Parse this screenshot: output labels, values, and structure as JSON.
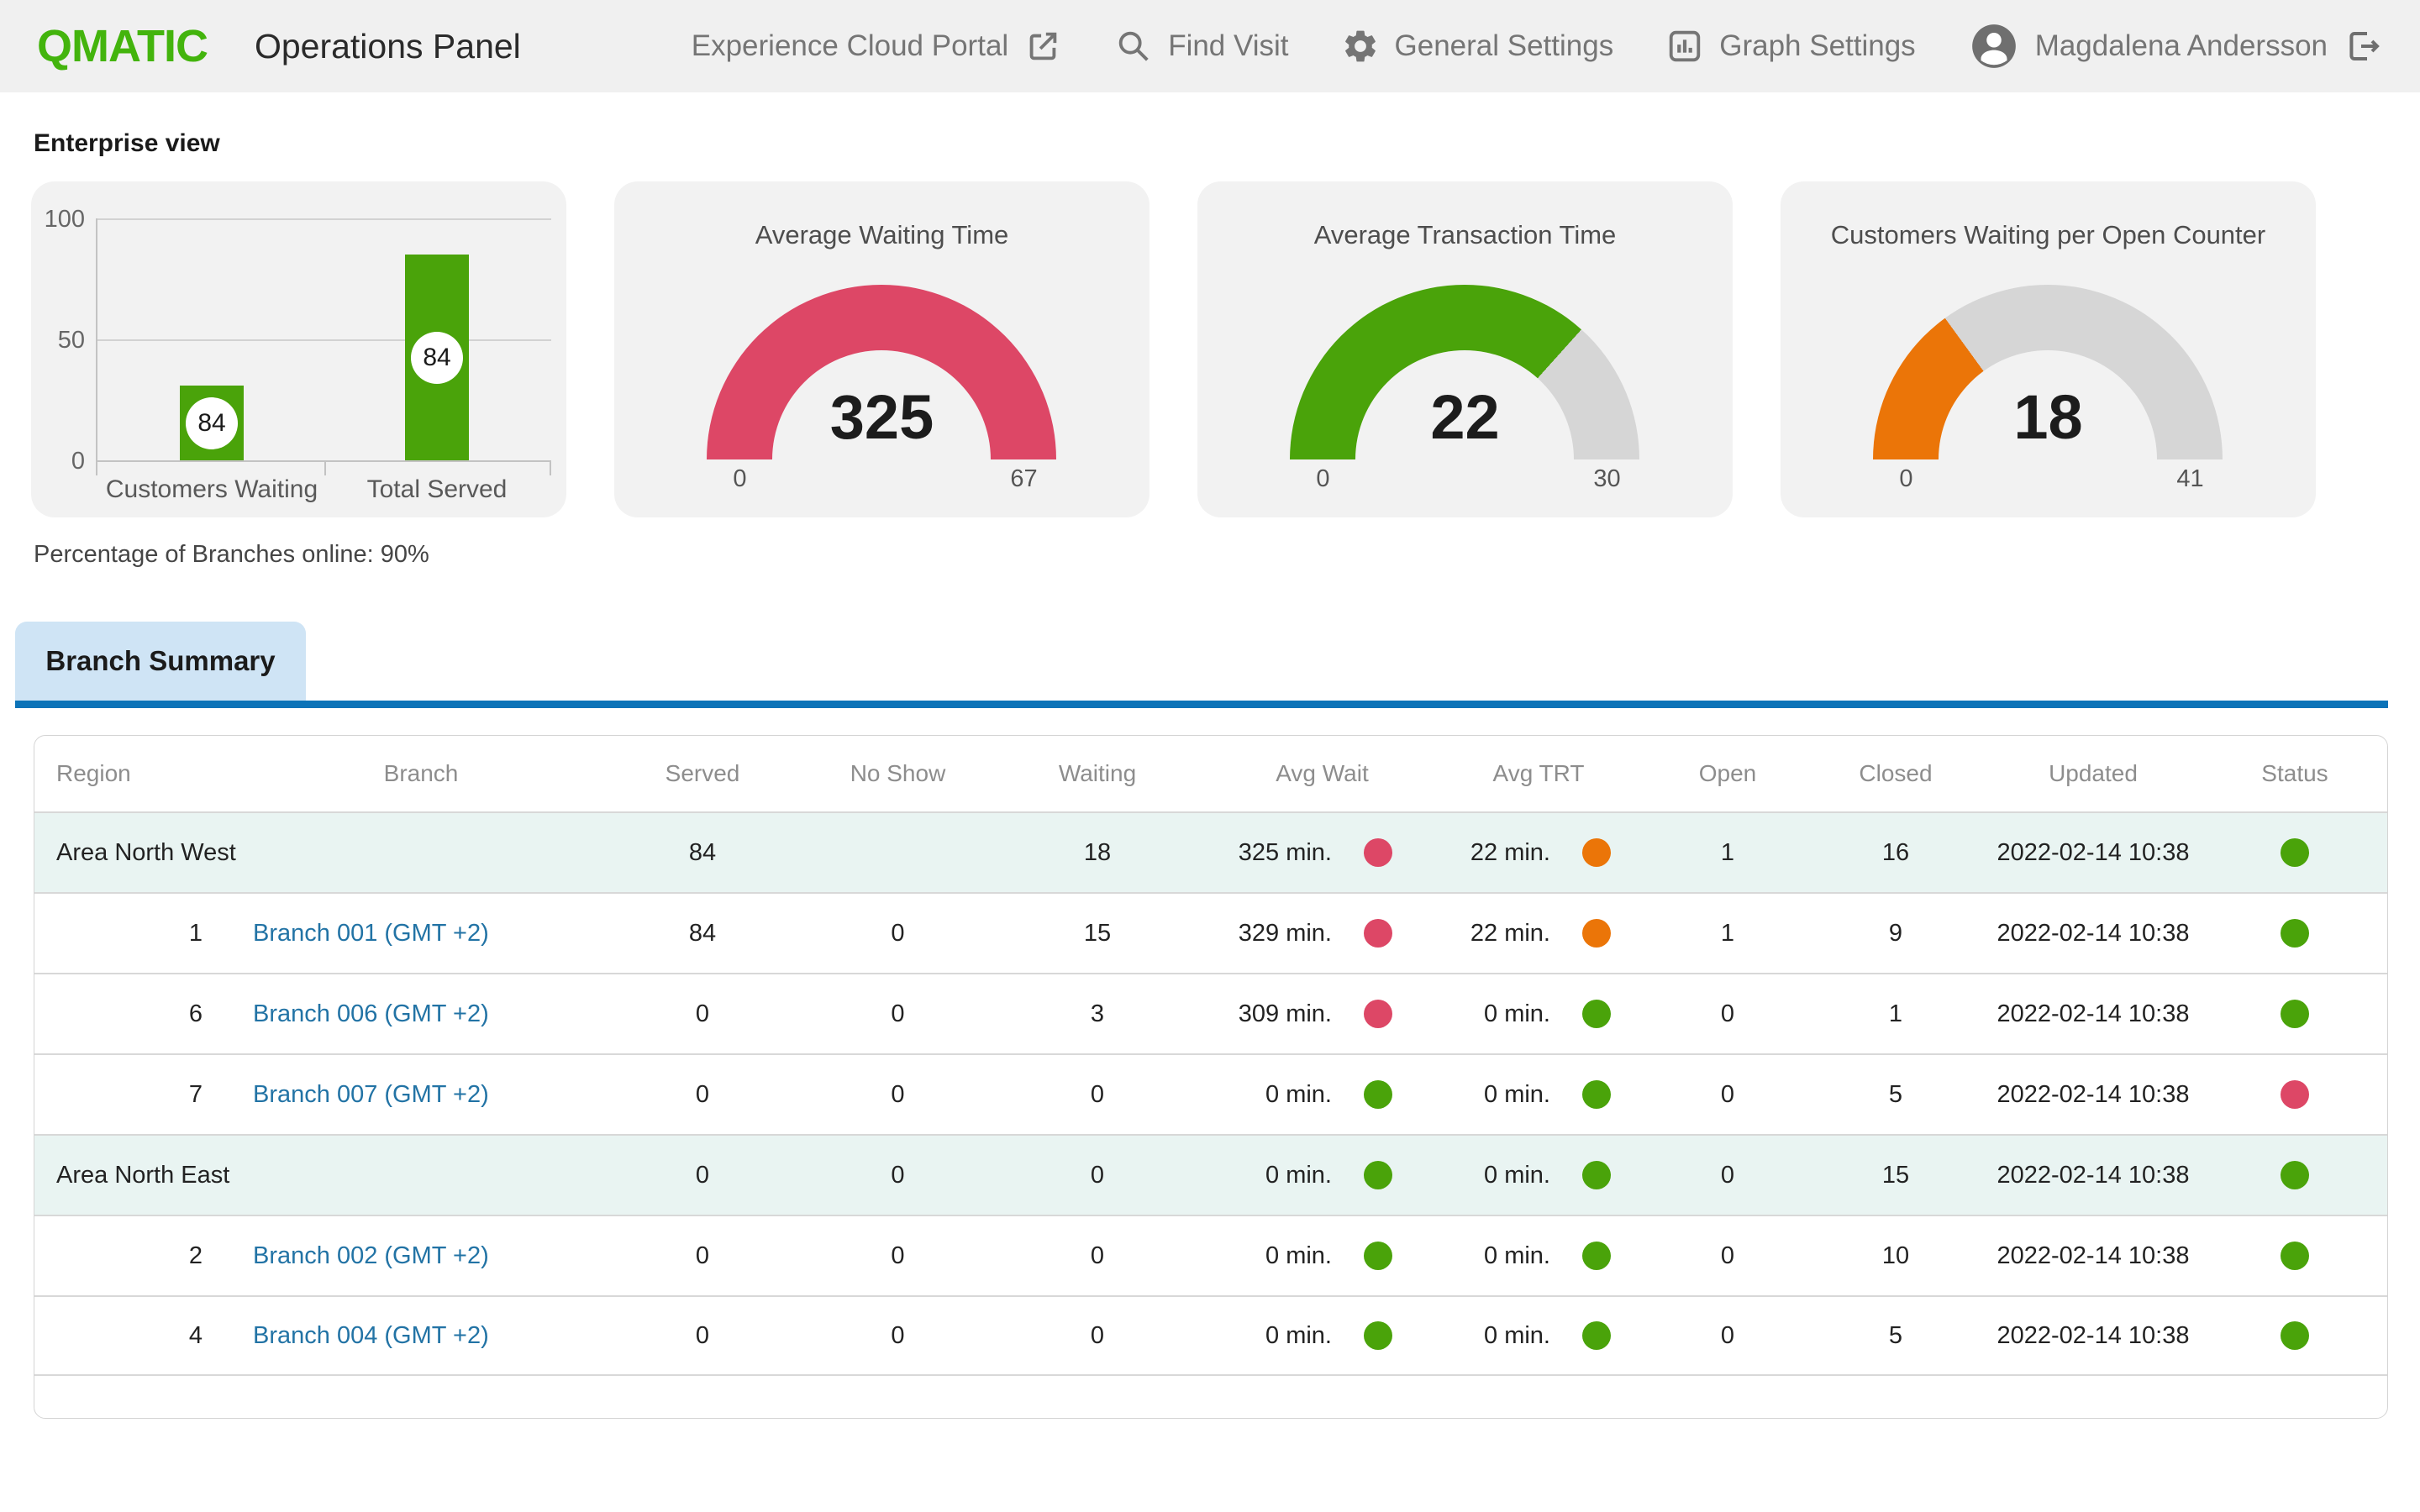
{
  "header": {
    "logo": "QMATIC",
    "title": "Operations Panel",
    "nav": [
      {
        "label": "Experience Cloud Portal",
        "icon": "external-link-icon"
      },
      {
        "label": "Find Visit",
        "icon": "search-icon"
      },
      {
        "label": "General Settings",
        "icon": "gear-icon"
      },
      {
        "label": "Graph Settings",
        "icon": "bar-chart-icon"
      }
    ],
    "user": {
      "name": "Magdalena Andersson",
      "icon": "avatar-icon",
      "logout_icon": "logout-icon"
    }
  },
  "enterprise": {
    "heading": "Enterprise view",
    "branches_online": "Percentage of Branches online: 90%"
  },
  "chart_data": [
    {
      "type": "bar",
      "title": "Enterprise view",
      "categories": [
        "Customers Waiting",
        "Total Served"
      ],
      "values": [
        84,
        84
      ],
      "visual_bar_heights_units": [
        31,
        85
      ],
      "ylim": [
        0,
        100
      ],
      "yticks": [
        "100",
        "50",
        "0"
      ],
      "bar_color": "#4aa30a",
      "grid": "on",
      "legend": "off"
    },
    {
      "type": "gauge",
      "title": "Average Waiting Time",
      "value": 325,
      "min": 0,
      "max": 67,
      "color": "#dd4766",
      "track_color": "#d6d6d6",
      "fill_fraction": 1
    },
    {
      "type": "gauge",
      "title": "Average Transaction Time",
      "value": 22,
      "min": 0,
      "max": 30,
      "color": "#4aa30a",
      "track_color": "#d6d6d6",
      "fill_fraction": 0.733
    },
    {
      "type": "gauge",
      "title": "Customers Waiting per Open Counter",
      "value": 18,
      "min": 0,
      "max": 41,
      "color": "#eb7508",
      "track_color": "#d6d6d6",
      "fill_fraction": 0.3
    }
  ],
  "tabs": [
    {
      "label": "Branch Summary",
      "active": true
    }
  ],
  "table": {
    "columns": [
      "Region",
      "Branch",
      "Served",
      "No Show",
      "Waiting",
      "Avg Wait",
      "Avg TRT",
      "Open",
      "Closed",
      "Updated",
      "Status"
    ],
    "rows": [
      {
        "type": "area",
        "region": "Area North West",
        "branch": "",
        "served": "84",
        "no_show": "",
        "waiting": "18",
        "avg_wait": "325 min.",
        "avg_wait_color": "#dd4766",
        "avg_trt": "22 min.",
        "avg_trt_color": "#eb7508",
        "open": "1",
        "closed": "16",
        "updated": "2022-02-14 10:38",
        "status_color": "#4aa30a"
      },
      {
        "type": "branch",
        "region": "1",
        "branch": "Branch 001 (GMT +2)",
        "served": "84",
        "no_show": "0",
        "waiting": "15",
        "avg_wait": "329 min.",
        "avg_wait_color": "#dd4766",
        "avg_trt": "22 min.",
        "avg_trt_color": "#eb7508",
        "open": "1",
        "closed": "9",
        "updated": "2022-02-14 10:38",
        "status_color": "#4aa30a"
      },
      {
        "type": "branch",
        "region": "6",
        "branch": "Branch 006 (GMT +2)",
        "served": "0",
        "no_show": "0",
        "waiting": "3",
        "avg_wait": "309 min.",
        "avg_wait_color": "#dd4766",
        "avg_trt": "0 min.",
        "avg_trt_color": "#4aa30a",
        "open": "0",
        "closed": "1",
        "updated": "2022-02-14 10:38",
        "status_color": "#4aa30a"
      },
      {
        "type": "branch",
        "region": "7",
        "branch": "Branch 007 (GMT +2)",
        "served": "0",
        "no_show": "0",
        "waiting": "0",
        "avg_wait": "0 min.",
        "avg_wait_color": "#4aa30a",
        "avg_trt": "0 min.",
        "avg_trt_color": "#4aa30a",
        "open": "0",
        "closed": "5",
        "updated": "2022-02-14 10:38",
        "status_color": "#dd4766"
      },
      {
        "type": "area",
        "region": "Area North East",
        "branch": "",
        "served": "0",
        "no_show": "0",
        "waiting": "0",
        "avg_wait": "0 min.",
        "avg_wait_color": "#4aa30a",
        "avg_trt": "0 min.",
        "avg_trt_color": "#4aa30a",
        "open": "0",
        "closed": "15",
        "updated": "2022-02-14 10:38",
        "status_color": "#4aa30a"
      },
      {
        "type": "branch",
        "region": "2",
        "branch": "Branch 002 (GMT +2)",
        "served": "0",
        "no_show": "0",
        "waiting": "0",
        "avg_wait": "0 min.",
        "avg_wait_color": "#4aa30a",
        "avg_trt": "0 min.",
        "avg_trt_color": "#4aa30a",
        "open": "0",
        "closed": "10",
        "updated": "2022-02-14 10:38",
        "status_color": "#4aa30a"
      },
      {
        "type": "branch",
        "region": "4",
        "branch": "Branch 004 (GMT +2)",
        "served": "0",
        "no_show": "0",
        "waiting": "0",
        "avg_wait": "0 min.",
        "avg_wait_color": "#4aa30a",
        "avg_trt": "0 min.",
        "avg_trt_color": "#4aa30a",
        "open": "0",
        "closed": "5",
        "updated": "2022-02-14 10:38",
        "status_color": "#4aa30a"
      }
    ]
  },
  "colors": {
    "brand_green": "#43b40d",
    "kpi_green": "#4aa30a",
    "kpi_pink": "#dd4766",
    "kpi_orange": "#eb7508",
    "link_blue": "#2273a5",
    "tab_bg": "#cfe4f5",
    "tab_underline": "#0c73b8",
    "area_row_bg": "#e9f4f2",
    "card_bg": "#f2f2f2"
  }
}
